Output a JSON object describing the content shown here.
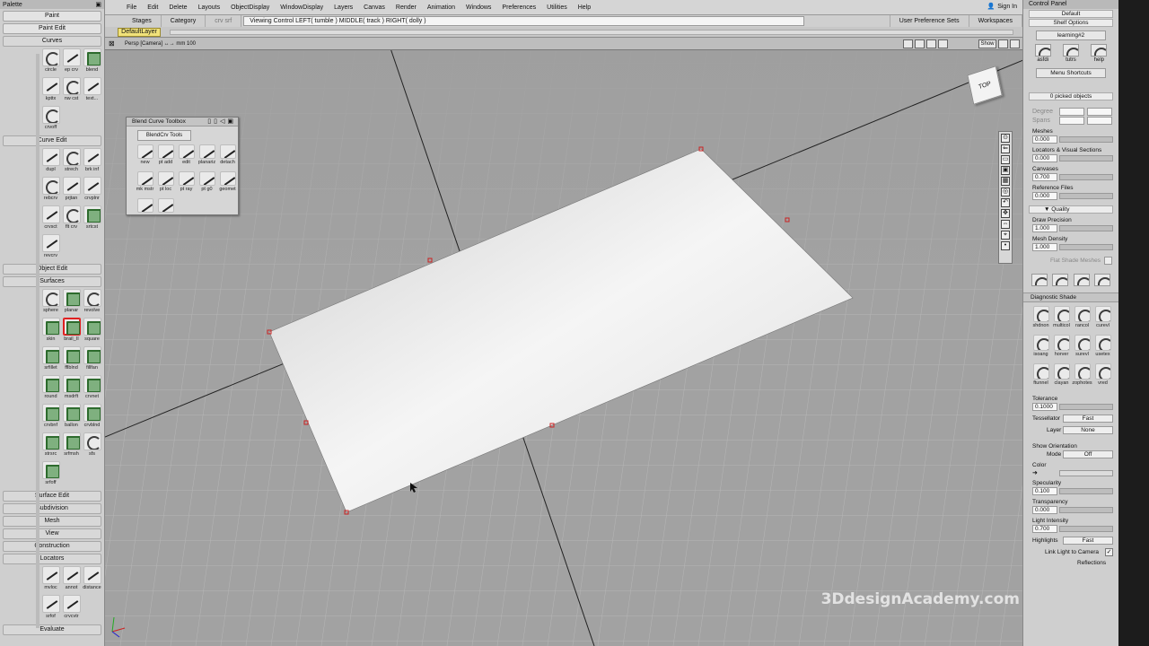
{
  "palette": {
    "title": "Palette",
    "tabs": [
      "Paint",
      "Paint Edit"
    ],
    "curves": {
      "label": "Curves",
      "tools": [
        "circle",
        "ep crv",
        "blend",
        "kpttx",
        "nw cst",
        "text...",
        "crvoff"
      ]
    },
    "curve_edit": {
      "label": "Curve Edit",
      "tools": [
        "dupl",
        "strech",
        "brk inf",
        "rebcrv",
        "prjtan",
        "crvplnr",
        "crvsct",
        "flt crv",
        "srtcst",
        "revcrv"
      ]
    },
    "object_edit": "Object Edit",
    "surfaces": {
      "label": "Surfaces",
      "tools": [
        "sphere",
        "planar",
        "revolve",
        "skin",
        "brail_II",
        "square",
        "srfillet",
        "fflblnd",
        "fillfan",
        "round",
        "msdrft",
        "crvnet",
        "crvbnf",
        "ballon",
        "crvblnd",
        "strsrc",
        "srfmsh",
        "sfs",
        "srfoff"
      ]
    },
    "sections": [
      "Surface Edit",
      "Subdivision",
      "Mesh",
      "View",
      "Construction"
    ],
    "locators": {
      "label": "Locators",
      "tools": [
        "mvloc",
        "annot",
        "distance",
        "srfof",
        "crvcvtr"
      ]
    },
    "evaluate": "Evaluate"
  },
  "menubar": {
    "items": [
      "File",
      "Edit",
      "Delete",
      "Layouts",
      "ObjectDisplay",
      "WindowDisplay",
      "Layers",
      "Canvas",
      "Render",
      "Animation",
      "Windows",
      "Preferences",
      "Utilities",
      "Help"
    ],
    "sign_in": "Sign In"
  },
  "stagebar": {
    "stages": "Stages",
    "category": "Category",
    "current_tool": "crv srf",
    "status": "Viewing Control   LEFT( tumble )   MIDDLE( track )   RIGHT( dolly )",
    "user_prefs": "User Preference Sets",
    "workspaces": "Workspaces"
  },
  "layerbar": {
    "default_layer": "DefaultLayer"
  },
  "viewport": {
    "label": "Persp [Camera]  ↔→ mm    100",
    "show_label": "Show",
    "cube_label": "TOP",
    "watermark": "3DdesignAcademy.com"
  },
  "toolbox": {
    "title": "Blend Curve Toolbox",
    "tab": "BlendCrv Tools",
    "tools": [
      "new",
      "pt add",
      "edit",
      "planariz",
      "detach",
      "mk mstr",
      "pt loc",
      "pt ray",
      "pt g0",
      "geomet",
      "",
      ""
    ]
  },
  "control_panel": {
    "title": "Control Panel",
    "preset": "Default",
    "shelf_options": "Shelf Options",
    "shelf_tab": "learning#2",
    "shelf_tools": [
      "asfdi",
      "tutrs",
      "help"
    ],
    "menu_shortcuts": "Menu Shortcuts",
    "picked": "0 picked objects",
    "degree_label": "Degree",
    "spans_label": "Spans",
    "meshes": {
      "label": "Meshes",
      "value": "0.000"
    },
    "locators": {
      "label": "Locators & Visual Sections",
      "value": "0.000"
    },
    "canvases": {
      "label": "Canvases",
      "value": "0.700"
    },
    "reference_files": {
      "label": "Reference Files",
      "value": "0.000"
    },
    "quality_header": "▼ Quality",
    "draw_precision": {
      "label": "Draw Precision",
      "value": "1.000"
    },
    "mesh_density": {
      "label": "Mesh Density",
      "value": "1.000"
    },
    "flat_shade": "Flat Shade Meshes",
    "diagnostic_shade": {
      "title": "Diagnostic Shade",
      "tools": [
        "shdnon",
        "multicol",
        "rancol",
        "curevl",
        "isoang",
        "horver",
        "surevl",
        "usetex",
        "ftunnel",
        "clayan",
        "zophotes",
        "vred"
      ]
    },
    "tolerance": {
      "label": "Tolerance",
      "value": "0.1000"
    },
    "tessellator": {
      "label": "Tessellator",
      "value": "Fast"
    },
    "layer": {
      "label": "Layer",
      "value": "None"
    },
    "show_orientation": "Show Orientation",
    "mode": {
      "label": "Mode",
      "value": "Off"
    },
    "color_label": "Color",
    "specularity": {
      "label": "Specularity",
      "value": "0.100"
    },
    "transparency": {
      "label": "Transparency",
      "value": "0.000"
    },
    "light_intensity": {
      "label": "Light Intensity",
      "value": "0.700"
    },
    "highlights": {
      "label": "Highlights",
      "value": "Fast"
    },
    "link_light": "Link Light to Camera",
    "reflections": "Reflections"
  }
}
